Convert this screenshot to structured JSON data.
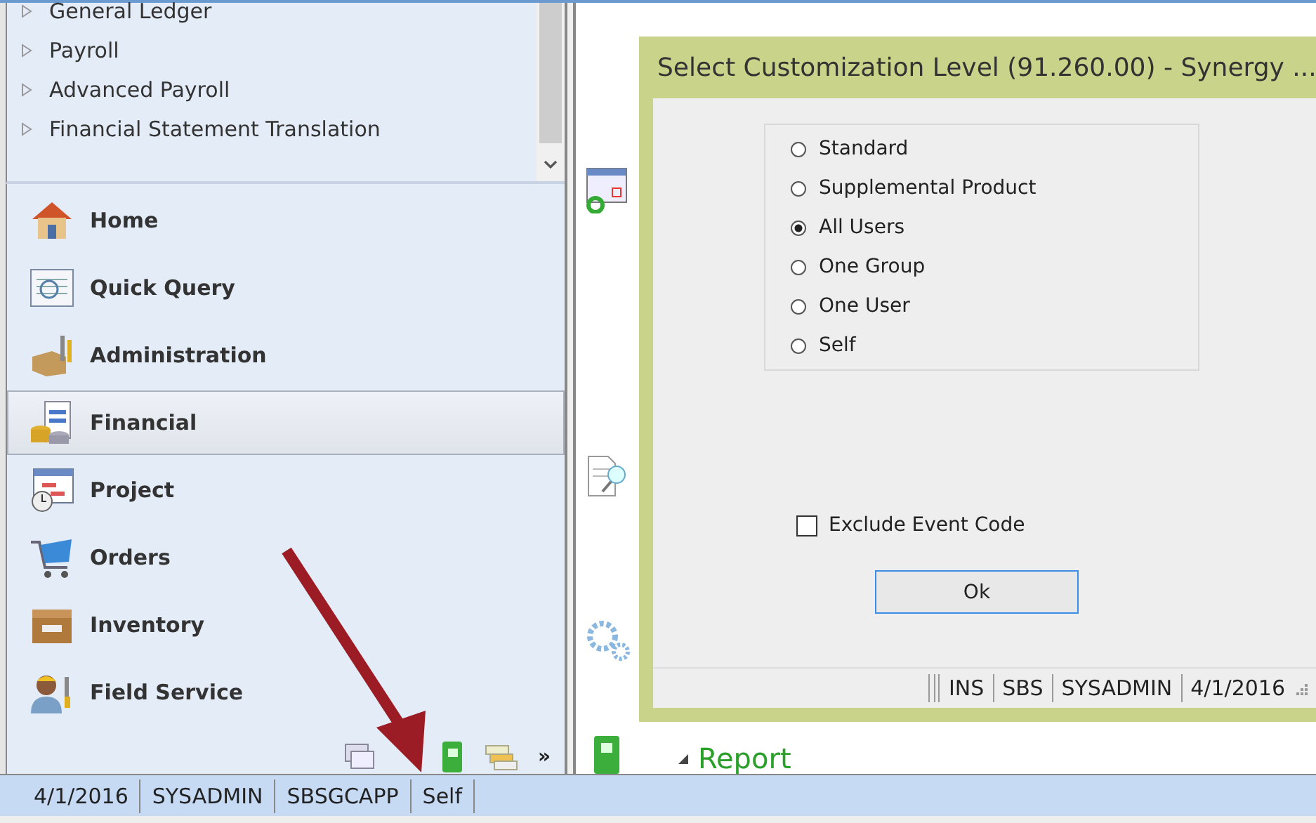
{
  "tree": {
    "items": [
      {
        "label": "General Ledger",
        "expanded": false
      },
      {
        "label": "Payroll",
        "expanded": false
      },
      {
        "label": "Advanced Payroll",
        "expanded": false
      },
      {
        "label": "Financial Statement Translation",
        "expanded": false
      }
    ]
  },
  "nav": {
    "items": [
      {
        "label": "Home",
        "kind": "home",
        "selected": false
      },
      {
        "label": "Quick Query",
        "kind": "query",
        "selected": false
      },
      {
        "label": "Administration",
        "kind": "admin",
        "selected": false
      },
      {
        "label": "Financial",
        "kind": "financial",
        "selected": true
      },
      {
        "label": "Project",
        "kind": "project",
        "selected": false
      },
      {
        "label": "Orders",
        "kind": "orders",
        "selected": false
      },
      {
        "label": "Inventory",
        "kind": "inventory",
        "selected": false
      },
      {
        "label": "Field Service",
        "kind": "service",
        "selected": false
      }
    ],
    "overflow": "»"
  },
  "report": {
    "label": "Report",
    "expanded": true
  },
  "dialog": {
    "title": "Select Customization Level (91.260.00) - Synergy ...",
    "options": [
      {
        "label": "Standard",
        "selected": false
      },
      {
        "label": "Supplemental Product",
        "selected": false
      },
      {
        "label": "All Users",
        "selected": true
      },
      {
        "label": "One Group",
        "selected": false
      },
      {
        "label": "One User",
        "selected": false
      },
      {
        "label": "Self",
        "selected": false
      }
    ],
    "checkbox": {
      "label": "Exclude Event Code",
      "checked": false
    },
    "ok_button": "Ok",
    "status_fields": [
      "INS",
      "SBS",
      "SYSADMIN",
      "4/1/2016"
    ]
  },
  "status_bar": {
    "fields": [
      "4/1/2016",
      "SYSADMIN",
      "SBSGCAPP",
      "Self"
    ]
  }
}
